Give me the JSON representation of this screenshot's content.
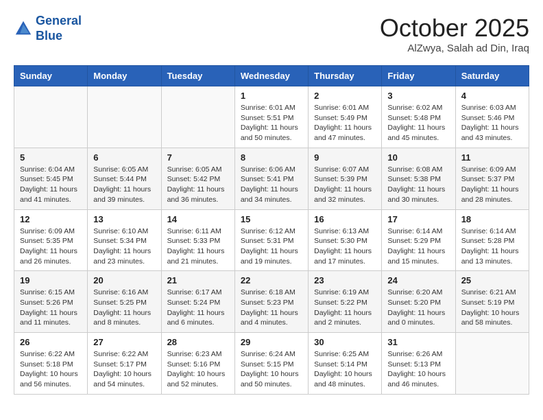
{
  "header": {
    "logo_line1": "General",
    "logo_line2": "Blue",
    "month_title": "October 2025",
    "location": "AlZwya, Salah ad Din, Iraq"
  },
  "days_of_week": [
    "Sunday",
    "Monday",
    "Tuesday",
    "Wednesday",
    "Thursday",
    "Friday",
    "Saturday"
  ],
  "weeks": [
    [
      {
        "day": "",
        "info": ""
      },
      {
        "day": "",
        "info": ""
      },
      {
        "day": "",
        "info": ""
      },
      {
        "day": "1",
        "info": "Sunrise: 6:01 AM\nSunset: 5:51 PM\nDaylight: 11 hours\nand 50 minutes."
      },
      {
        "day": "2",
        "info": "Sunrise: 6:01 AM\nSunset: 5:49 PM\nDaylight: 11 hours\nand 47 minutes."
      },
      {
        "day": "3",
        "info": "Sunrise: 6:02 AM\nSunset: 5:48 PM\nDaylight: 11 hours\nand 45 minutes."
      },
      {
        "day": "4",
        "info": "Sunrise: 6:03 AM\nSunset: 5:46 PM\nDaylight: 11 hours\nand 43 minutes."
      }
    ],
    [
      {
        "day": "5",
        "info": "Sunrise: 6:04 AM\nSunset: 5:45 PM\nDaylight: 11 hours\nand 41 minutes."
      },
      {
        "day": "6",
        "info": "Sunrise: 6:05 AM\nSunset: 5:44 PM\nDaylight: 11 hours\nand 39 minutes."
      },
      {
        "day": "7",
        "info": "Sunrise: 6:05 AM\nSunset: 5:42 PM\nDaylight: 11 hours\nand 36 minutes."
      },
      {
        "day": "8",
        "info": "Sunrise: 6:06 AM\nSunset: 5:41 PM\nDaylight: 11 hours\nand 34 minutes."
      },
      {
        "day": "9",
        "info": "Sunrise: 6:07 AM\nSunset: 5:39 PM\nDaylight: 11 hours\nand 32 minutes."
      },
      {
        "day": "10",
        "info": "Sunrise: 6:08 AM\nSunset: 5:38 PM\nDaylight: 11 hours\nand 30 minutes."
      },
      {
        "day": "11",
        "info": "Sunrise: 6:09 AM\nSunset: 5:37 PM\nDaylight: 11 hours\nand 28 minutes."
      }
    ],
    [
      {
        "day": "12",
        "info": "Sunrise: 6:09 AM\nSunset: 5:35 PM\nDaylight: 11 hours\nand 26 minutes."
      },
      {
        "day": "13",
        "info": "Sunrise: 6:10 AM\nSunset: 5:34 PM\nDaylight: 11 hours\nand 23 minutes."
      },
      {
        "day": "14",
        "info": "Sunrise: 6:11 AM\nSunset: 5:33 PM\nDaylight: 11 hours\nand 21 minutes."
      },
      {
        "day": "15",
        "info": "Sunrise: 6:12 AM\nSunset: 5:31 PM\nDaylight: 11 hours\nand 19 minutes."
      },
      {
        "day": "16",
        "info": "Sunrise: 6:13 AM\nSunset: 5:30 PM\nDaylight: 11 hours\nand 17 minutes."
      },
      {
        "day": "17",
        "info": "Sunrise: 6:14 AM\nSunset: 5:29 PM\nDaylight: 11 hours\nand 15 minutes."
      },
      {
        "day": "18",
        "info": "Sunrise: 6:14 AM\nSunset: 5:28 PM\nDaylight: 11 hours\nand 13 minutes."
      }
    ],
    [
      {
        "day": "19",
        "info": "Sunrise: 6:15 AM\nSunset: 5:26 PM\nDaylight: 11 hours\nand 11 minutes."
      },
      {
        "day": "20",
        "info": "Sunrise: 6:16 AM\nSunset: 5:25 PM\nDaylight: 11 hours\nand 8 minutes."
      },
      {
        "day": "21",
        "info": "Sunrise: 6:17 AM\nSunset: 5:24 PM\nDaylight: 11 hours\nand 6 minutes."
      },
      {
        "day": "22",
        "info": "Sunrise: 6:18 AM\nSunset: 5:23 PM\nDaylight: 11 hours\nand 4 minutes."
      },
      {
        "day": "23",
        "info": "Sunrise: 6:19 AM\nSunset: 5:22 PM\nDaylight: 11 hours\nand 2 minutes."
      },
      {
        "day": "24",
        "info": "Sunrise: 6:20 AM\nSunset: 5:20 PM\nDaylight: 11 hours\nand 0 minutes."
      },
      {
        "day": "25",
        "info": "Sunrise: 6:21 AM\nSunset: 5:19 PM\nDaylight: 10 hours\nand 58 minutes."
      }
    ],
    [
      {
        "day": "26",
        "info": "Sunrise: 6:22 AM\nSunset: 5:18 PM\nDaylight: 10 hours\nand 56 minutes."
      },
      {
        "day": "27",
        "info": "Sunrise: 6:22 AM\nSunset: 5:17 PM\nDaylight: 10 hours\nand 54 minutes."
      },
      {
        "day": "28",
        "info": "Sunrise: 6:23 AM\nSunset: 5:16 PM\nDaylight: 10 hours\nand 52 minutes."
      },
      {
        "day": "29",
        "info": "Sunrise: 6:24 AM\nSunset: 5:15 PM\nDaylight: 10 hours\nand 50 minutes."
      },
      {
        "day": "30",
        "info": "Sunrise: 6:25 AM\nSunset: 5:14 PM\nDaylight: 10 hours\nand 48 minutes."
      },
      {
        "day": "31",
        "info": "Sunrise: 6:26 AM\nSunset: 5:13 PM\nDaylight: 10 hours\nand 46 minutes."
      },
      {
        "day": "",
        "info": ""
      }
    ]
  ]
}
